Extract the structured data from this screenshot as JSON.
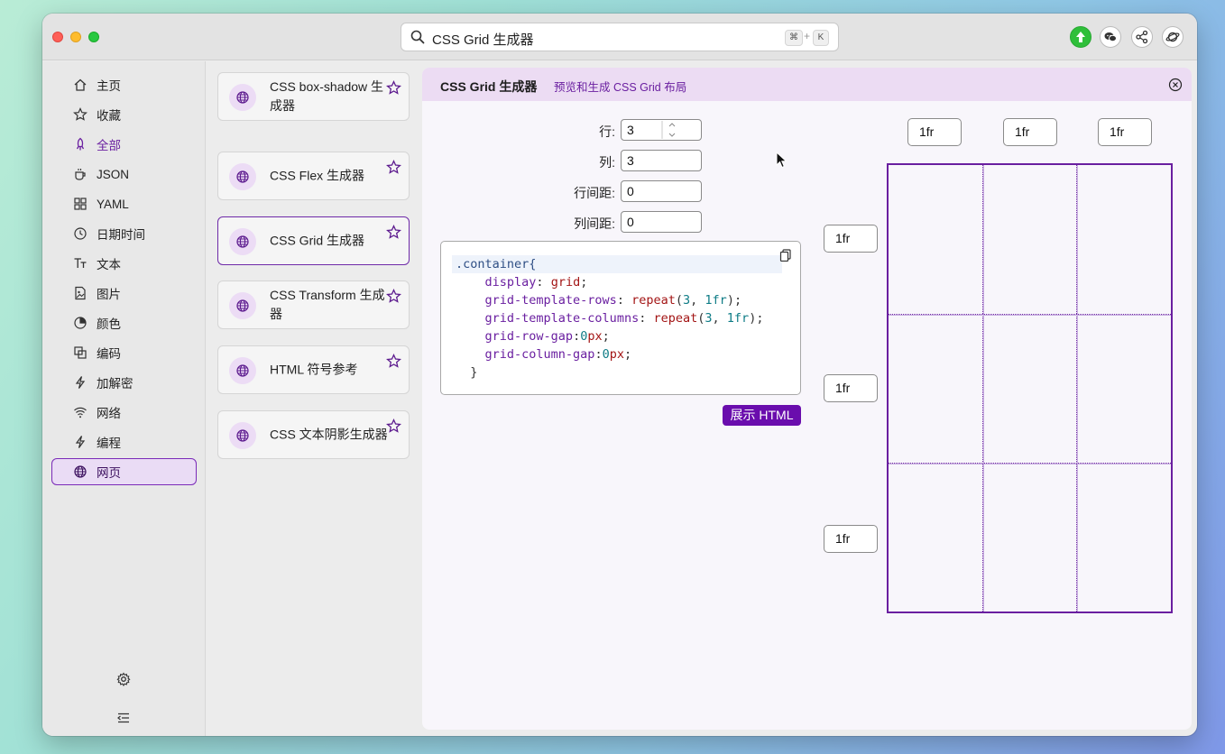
{
  "search": {
    "text": "CSS Grid 生成器",
    "kbd_cmd": "⌘",
    "kbd_plus": "+",
    "kbd_key": "K"
  },
  "toolbar": {
    "icons": [
      "upload-icon",
      "wechat-icon",
      "share-icon",
      "planet-icon"
    ]
  },
  "sidebar": {
    "items": [
      {
        "label": "主页",
        "icon": "home-icon"
      },
      {
        "label": "收藏",
        "icon": "star-icon"
      },
      {
        "label": "全部",
        "icon": "rocket-icon"
      },
      {
        "label": "JSON",
        "icon": "coffee-icon"
      },
      {
        "label": "YAML",
        "icon": "grid-icon"
      },
      {
        "label": "日期时间",
        "icon": "clock-icon"
      },
      {
        "label": "文本",
        "icon": "text-icon"
      },
      {
        "label": "图片",
        "icon": "image-icon"
      },
      {
        "label": "颜色",
        "icon": "palette-icon"
      },
      {
        "label": "编码",
        "icon": "encode-icon"
      },
      {
        "label": "加解密",
        "icon": "bolt-icon"
      },
      {
        "label": "网络",
        "icon": "wifi-icon"
      },
      {
        "label": "编程",
        "icon": "bolt-icon"
      },
      {
        "label": "网页",
        "icon": "globe-icon"
      }
    ],
    "selected": "网页",
    "accent": "全部"
  },
  "tools": [
    {
      "label": "CSS box-shadow 生成器"
    },
    {
      "label": "CSS Flex 生成器"
    },
    {
      "label": "CSS Grid 生成器"
    },
    {
      "label": "CSS Transform 生成器"
    },
    {
      "label": "HTML 符号参考"
    },
    {
      "label": "CSS 文本阴影生成器"
    }
  ],
  "main": {
    "title": "CSS Grid 生成器",
    "subtitle": "预览和生成 CSS Grid 布局",
    "form": {
      "rows_label": "行:",
      "rows_value": "3",
      "cols_label": "列:",
      "cols_value": "3",
      "row_gap_label": "行间距:",
      "row_gap_value": "0",
      "col_gap_label": "列间距:",
      "col_gap_value": "0"
    },
    "code": {
      "line1": ".container{",
      "line2_prop": "display",
      "line2_val": "grid",
      "line3_prop": "grid-template-rows",
      "line3_fn": "repeat",
      "line3_num": "3",
      "line3_unit": "1fr",
      "line4_prop": "grid-template-columns",
      "line4_fn": "repeat",
      "line4_num": "3",
      "line4_unit": "1fr",
      "line5_prop": "grid-row-gap",
      "line5_num": "0",
      "line5_unit": "px",
      "line6_prop": "grid-column-gap",
      "line6_num": "0",
      "line6_unit": "px",
      "line7": "}"
    },
    "show_html_label": "展示 HTML",
    "col_fr": [
      "1fr",
      "1fr",
      "1fr"
    ],
    "row_fr": [
      "1fr",
      "1fr",
      "1fr"
    ]
  },
  "colors": {
    "accent": "#6a0dad",
    "selected_bg": "#eadcf5",
    "header_bg": "#ecdcf3"
  }
}
